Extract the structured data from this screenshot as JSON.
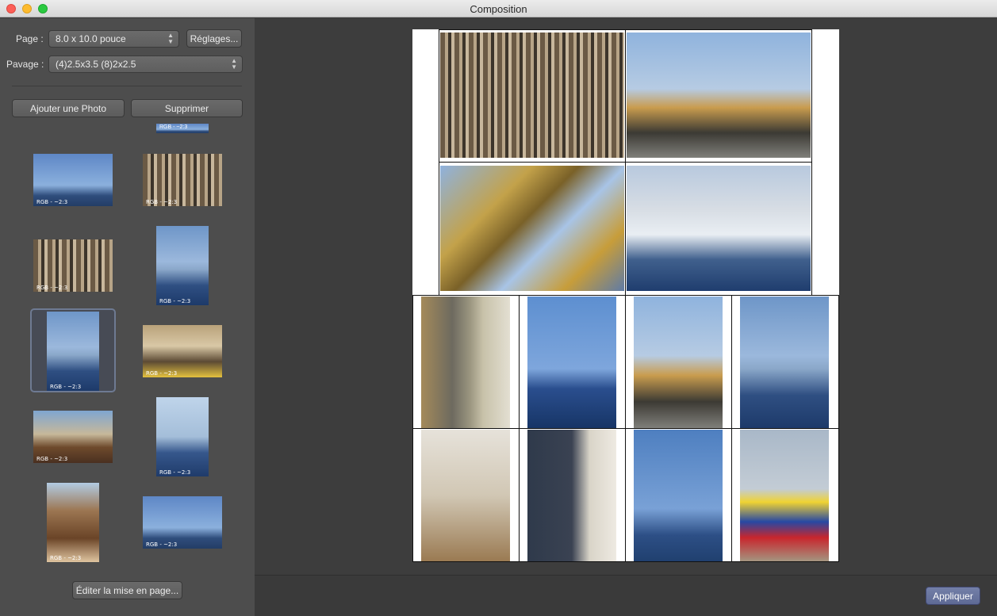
{
  "window": {
    "title": "Composition"
  },
  "sidebar": {
    "page_label": "Page :",
    "page_value": "8.0 x 10.0 pouce",
    "settings_button": "Réglages...",
    "tiling_label": "Pavage :",
    "tiling_value": "(4)2.5x3.5 (8)2x2.5",
    "add_photo_button": "Ajouter une Photo",
    "delete_button": "Supprimer",
    "edit_layout_button": "Éditer la mise en page...",
    "thumbnails": [
      {
        "tag": "RGB - ~2:3"
      },
      {
        "tag": "RGB - ~2:3"
      },
      {
        "tag": "RGB - ~2:3"
      },
      {
        "tag": "RGB - ~2:3"
      },
      {
        "tag": "RGB - ~2:3"
      },
      {
        "tag": "RGB - ~2:3"
      },
      {
        "tag": "RGB - ~2:3"
      },
      {
        "tag": "RGB - ~2:3"
      },
      {
        "tag": "RGB - ~2:3"
      },
      {
        "tag": "RGB - ~2:3"
      },
      {
        "tag": "RGB - ~2:3"
      },
      {
        "tag": "RGB - ~2:3"
      }
    ]
  },
  "footer": {
    "apply_button": "Appliquer"
  }
}
